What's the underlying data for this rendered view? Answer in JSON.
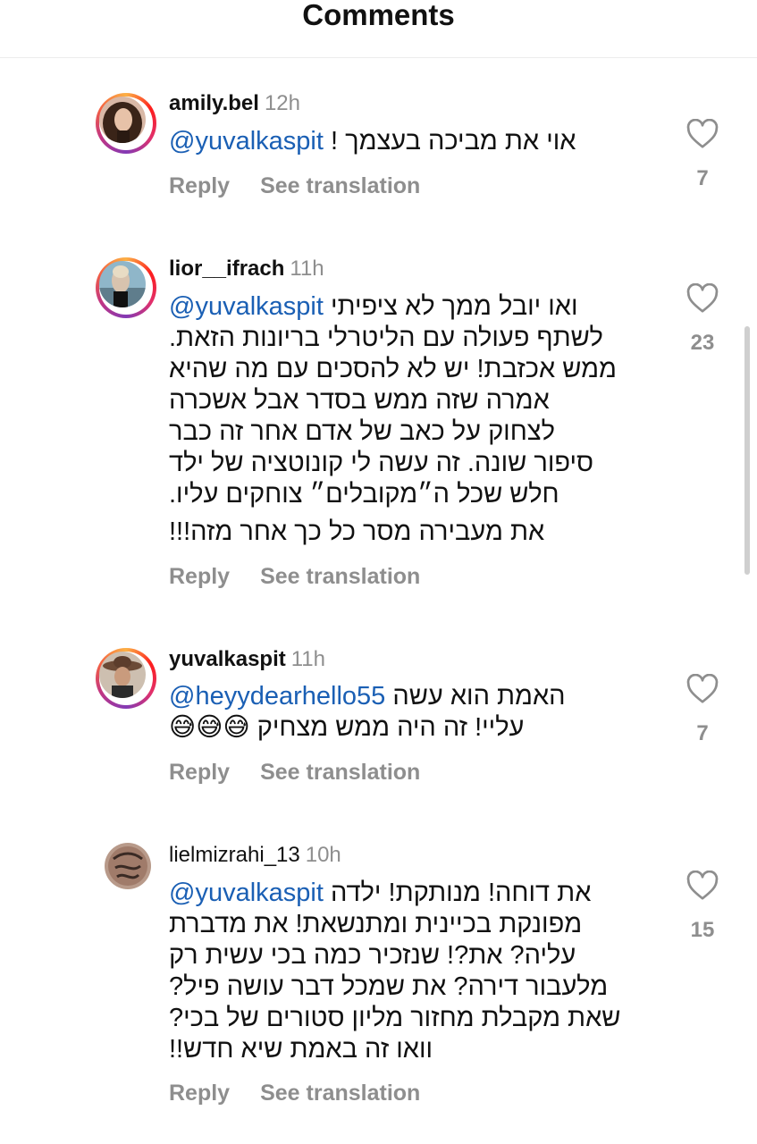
{
  "header": {
    "title": "Comments"
  },
  "actions": {
    "reply": "Reply",
    "see_translation": "See translation"
  },
  "comments": [
    {
      "username": "amily.bel",
      "time": "12h",
      "mention": "@yuvalkaspit",
      "lines": [
        "! אוי את מביכה בעצמך"
      ],
      "likes": "7"
    },
    {
      "username": "lior__ifrach",
      "time": "11h",
      "mention": "@yuvalkaspit",
      "lines": [
        "ואו יובל ממך לא ציפיתי",
        "לשתף פעולה עם הליטרלי בריונות הזאת.",
        "ממש אכזבת! יש לא להסכים עם מה שהיא",
        "אמרה שזה ממש בסדר אבל אשכרה",
        "לצחוק על כאב של אדם אחר זה כבר",
        "סיפור שונה. זה עשה לי קונוטציה של ילד",
        "חלש שכל ה״מקובלים״ צוחקים עליו."
      ],
      "extra_line": "את מעבירה מסר כל כך אחר מזה!!!",
      "likes": "23"
    },
    {
      "username": "yuvalkaspit",
      "time": "11h",
      "mention": "@heyydearhello55",
      "lines": [
        "האמת הוא עשה",
        "עליי! זה היה ממש מצחיק"
      ],
      "emoji": "😅😅😅",
      "likes": "7"
    },
    {
      "username": "lielmizrahi_13",
      "time": "10h",
      "mention": "@yuvalkaspit",
      "lines": [
        "את דוחה! מנותקת! ילדה",
        "מפונקת בכיינית ומתנשאת! את מדברת",
        "עליה? את?! שנזכיר כמה בכי עשית רק",
        "מלעבור דירה? את שמכל דבר עושה פיל?",
        "שאת מקבלת מחזור מליון סטורים של בכי?",
        "וואו זה באמת שיא חדש!!"
      ],
      "likes": "15"
    }
  ],
  "colors": {
    "mention": "#1a5fb4",
    "muted": "#8e8e8e",
    "text": "#111111"
  },
  "icons": {
    "like": "heart-outline-icon"
  }
}
